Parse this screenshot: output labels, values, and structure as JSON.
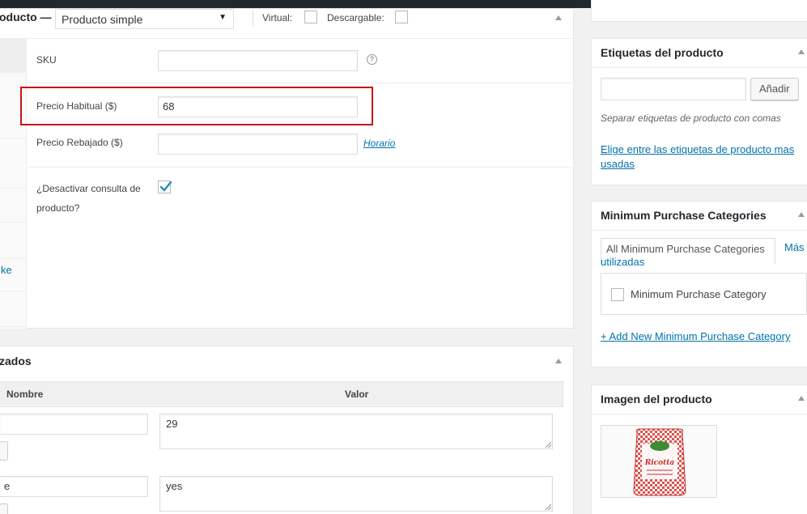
{
  "product_data": {
    "title": "oducto —",
    "type_select": "Producto simple",
    "virtual_label": "Virtual:",
    "downloadable_label": "Descargable:",
    "tab_link": "ke",
    "sku_label": "SKU",
    "sku_value": "",
    "regular_price_label": "Precio Habitual ($)",
    "regular_price_value": "68",
    "sale_price_label": "Precio Rebajado ($)",
    "sale_price_value": "",
    "schedule_link": "Horario",
    "disable_query_label_1": "¿Desactivar consulta de",
    "disable_query_label_2": "producto?",
    "disable_query_checked": true
  },
  "attributes": {
    "title": "zados",
    "col_name": "Nombre",
    "col_value": "Valor",
    "rows": [
      {
        "name": "",
        "value": "29"
      },
      {
        "name": "e",
        "value": "yes"
      }
    ]
  },
  "sidebar": {
    "tags": {
      "title": "Etiquetas del producto",
      "input_value": "",
      "add_button": "Añadir",
      "hint": "Separar etiquetas de producto con comas",
      "choose_link_1": "Elige entre las etiquetas de producto mas",
      "choose_link_2": "usadas"
    },
    "min_purchase": {
      "title": "Minimum Purchase Categories",
      "tab_all": "All Minimum Purchase Categories",
      "tab_most_1": "Más",
      "tab_most_2": "utilizadas",
      "category": "Minimum Purchase Category",
      "add_new_link": "+ Add New Minimum Purchase Category"
    },
    "product_image": {
      "title": "Imagen del producto",
      "image_label": "Ricotta"
    }
  },
  "colors": {
    "link": "#0073aa",
    "highlight": "#cc1212",
    "admin_bar": "#23282d"
  }
}
